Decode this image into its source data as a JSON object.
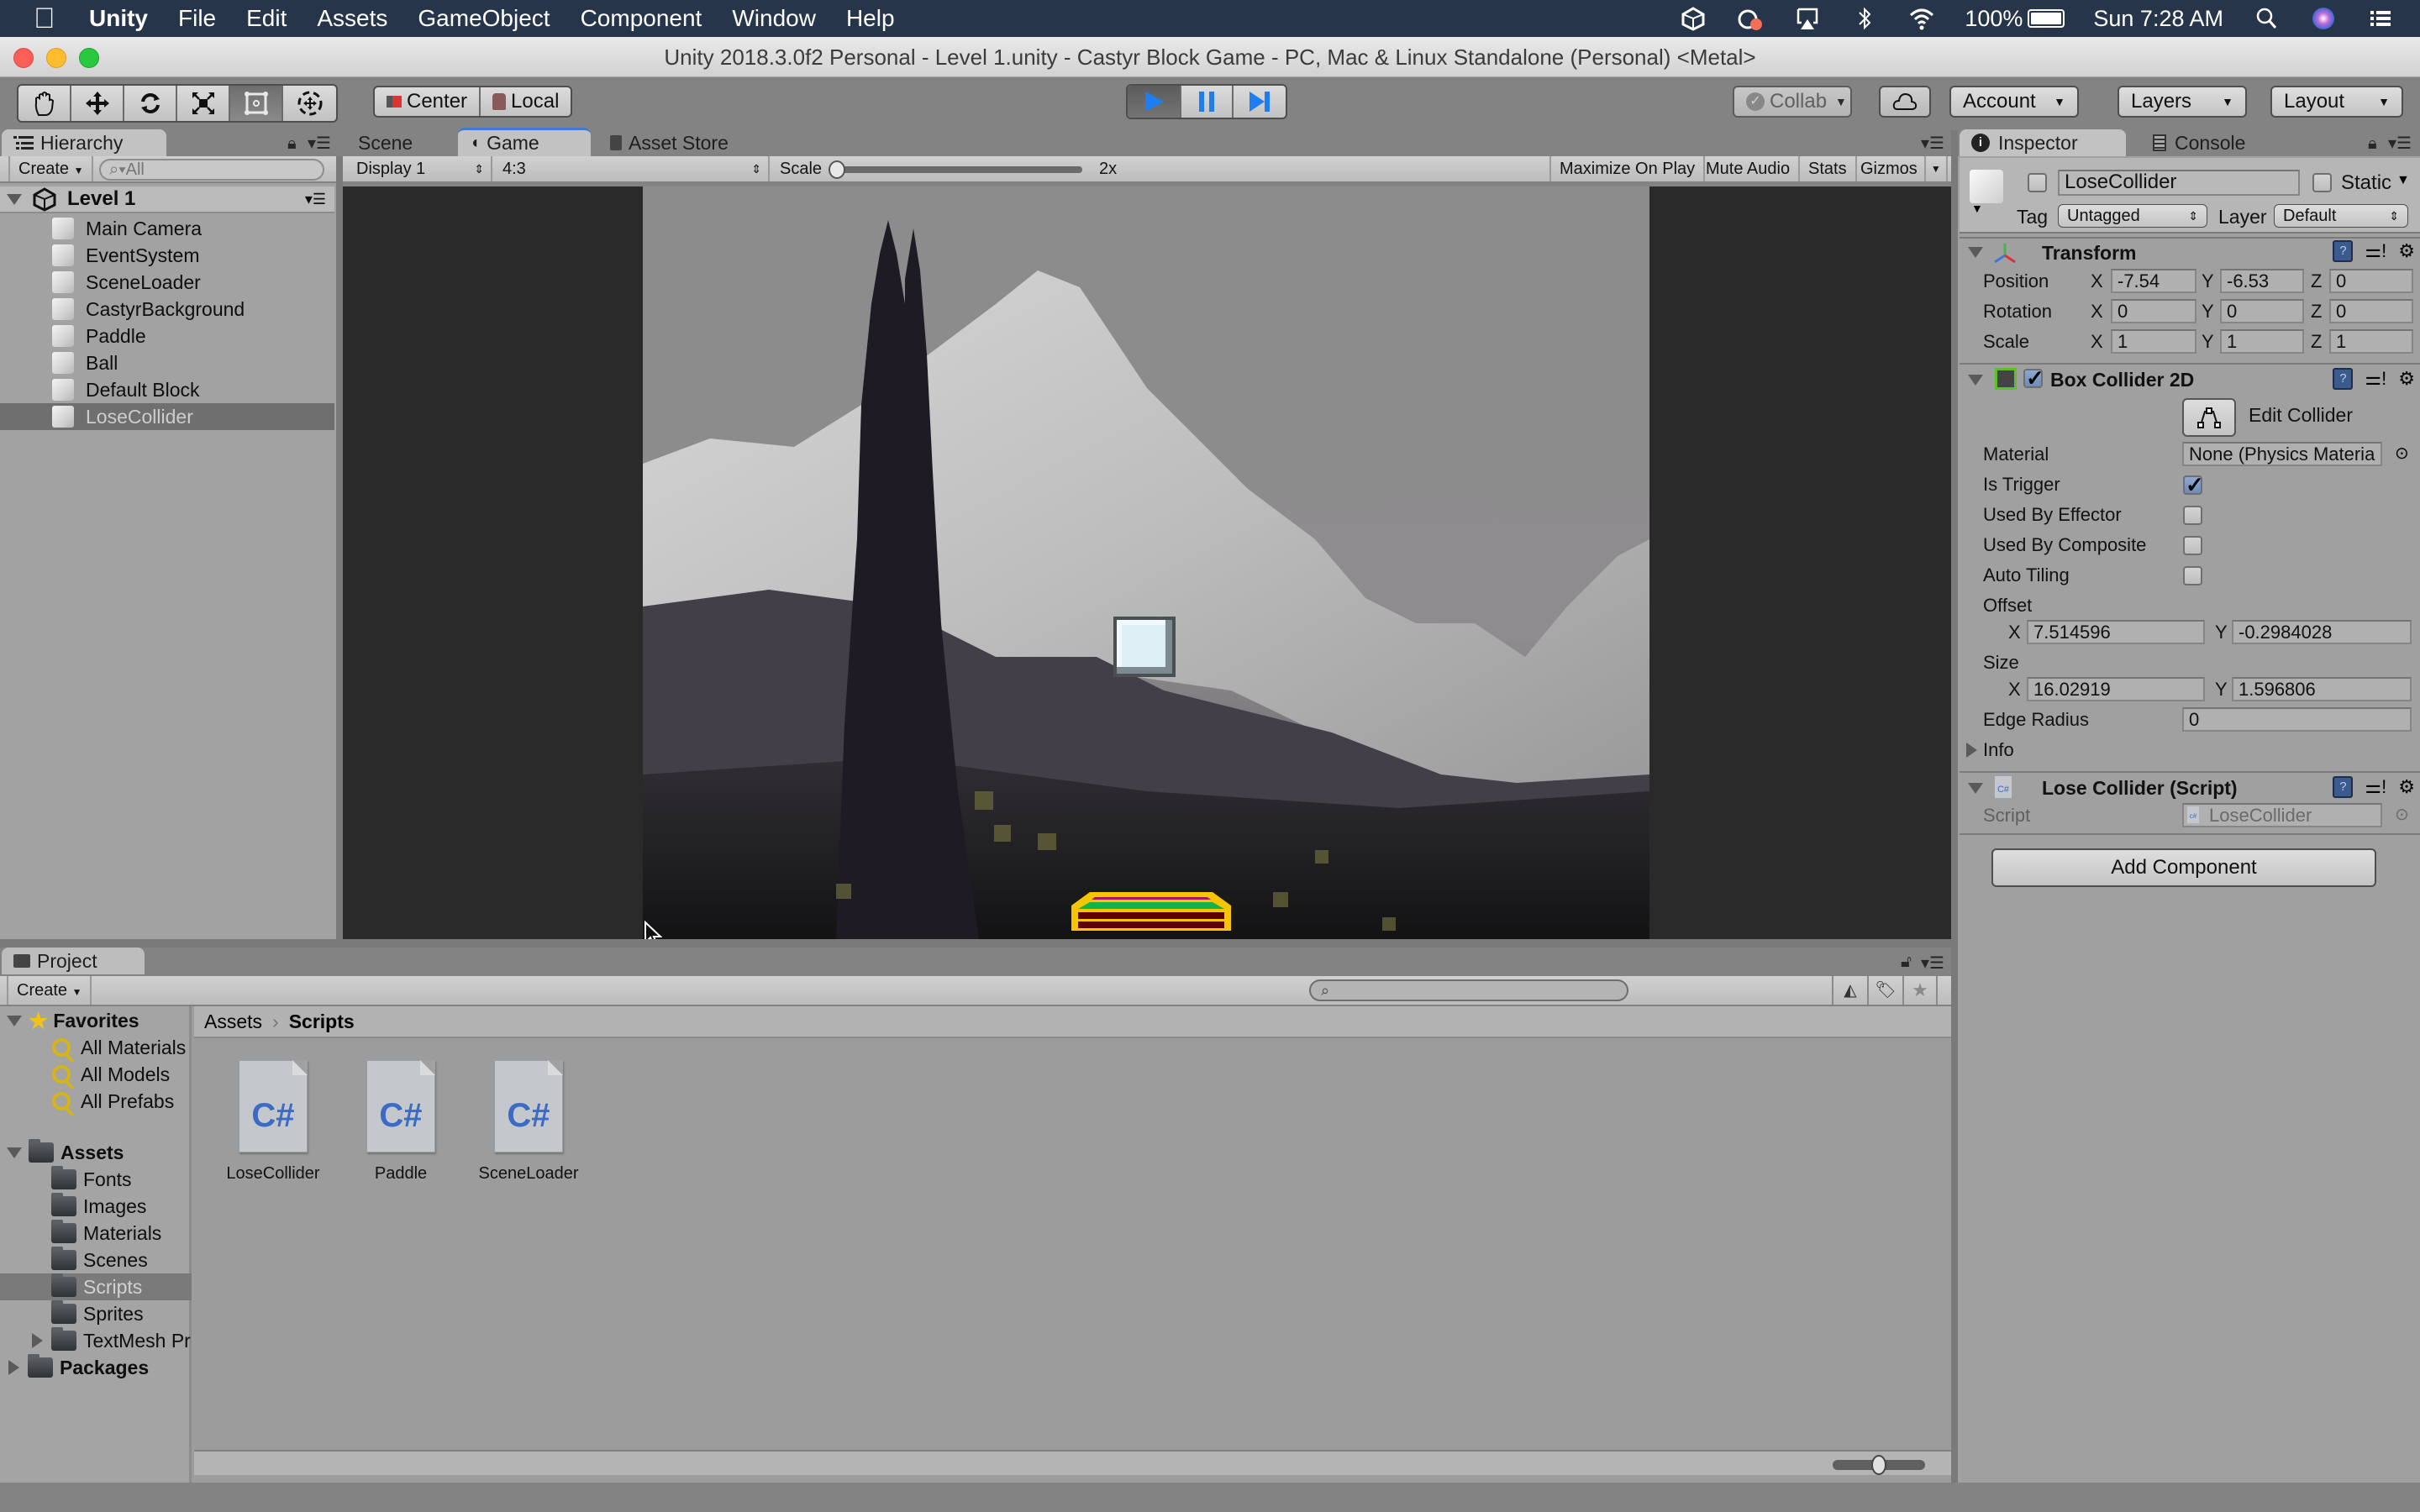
{
  "menubar": {
    "app_name": "Unity",
    "items": [
      "File",
      "Edit",
      "Assets",
      "GameObject",
      "Component",
      "Window",
      "Help"
    ],
    "status": {
      "battery": "100%",
      "clock": "Sun 7:28 AM",
      "icons": [
        "unity-hub-icon",
        "creative-cloud-icon",
        "airplay-icon",
        "bluetooth-icon",
        "wifi-icon",
        "battery-icon",
        "spotlight-icon",
        "siri-icon",
        "notification-center-icon"
      ]
    }
  },
  "window": {
    "title": "Unity 2018.3.0f2 Personal - Level 1.unity - Castyr Block Game - PC, Mac & Linux Standalone (Personal) <Metal>"
  },
  "toolbar": {
    "tools": [
      "hand",
      "move",
      "rotate",
      "scale",
      "rect",
      "transform"
    ],
    "active_tool": "rect",
    "pivot_mode": "Center",
    "pivot_rotation": "Local",
    "play_state": "playing",
    "collab_label": "Collab",
    "account_label": "Account",
    "layers_label": "Layers",
    "layout_label": "Layout"
  },
  "hierarchy": {
    "tab_label": "Hierarchy",
    "create_label": "Create",
    "search_placeholder": "All",
    "scene_name": "Level 1",
    "items": [
      {
        "label": "Main Camera",
        "selected": false
      },
      {
        "label": "EventSystem",
        "selected": false
      },
      {
        "label": "SceneLoader",
        "selected": false
      },
      {
        "label": "CastyrBackground",
        "selected": false
      },
      {
        "label": "Paddle",
        "selected": false
      },
      {
        "label": "Ball",
        "selected": false
      },
      {
        "label": "Default Block",
        "selected": false
      },
      {
        "label": "LoseCollider",
        "selected": true
      }
    ]
  },
  "center_tabs": {
    "tabs": [
      {
        "label": "Scene",
        "active": false
      },
      {
        "label": "Game",
        "active": true
      },
      {
        "label": "Asset Store",
        "active": false
      }
    ]
  },
  "game_view": {
    "display": "Display 1",
    "aspect": "4:3",
    "scale_label": "Scale",
    "scale_value": "2x",
    "scale_slider_fraction": 0.0,
    "buttons": [
      "Maximize On Play",
      "Mute Audio",
      "Stats",
      "Gizmos"
    ]
  },
  "inspector": {
    "tabs": [
      {
        "label": "Inspector",
        "active": true
      },
      {
        "label": "Console",
        "active": false
      }
    ],
    "object": {
      "active": false,
      "name": "LoseCollider",
      "static_label": "Static",
      "static": false,
      "tag_label": "Tag",
      "tag": "Untagged",
      "layer_label": "Layer",
      "layer": "Default"
    },
    "transform": {
      "title": "Transform",
      "rows": [
        {
          "label": "Position",
          "x": "-7.54",
          "y": "-6.53",
          "z": "0"
        },
        {
          "label": "Rotation",
          "x": "0",
          "y": "0",
          "z": "0"
        },
        {
          "label": "Scale",
          "x": "1",
          "y": "1",
          "z": "1"
        }
      ]
    },
    "box_collider": {
      "title": "Box Collider 2D",
      "enabled": true,
      "edit_collider_label": "Edit Collider",
      "material_label": "Material",
      "material_value": "None (Physics Materia",
      "is_trigger_label": "Is Trigger",
      "is_trigger": true,
      "used_by_effector_label": "Used By Effector",
      "used_by_effector": false,
      "used_by_composite_label": "Used By Composite",
      "used_by_composite": false,
      "auto_tiling_label": "Auto Tiling",
      "auto_tiling": false,
      "offset_label": "Offset",
      "offset_x": "7.514596",
      "offset_y": "-0.2984028",
      "size_label": "Size",
      "size_x": "16.02919",
      "size_y": "1.596806",
      "edge_radius_label": "Edge Radius",
      "edge_radius": "0",
      "info_label": "Info"
    },
    "script_component": {
      "title": "Lose Collider (Script)",
      "script_label": "Script",
      "script_value": "LoseCollider"
    },
    "add_component_label": "Add Component"
  },
  "project": {
    "tab_label": "Project",
    "create_label": "Create",
    "search_placeholder": "",
    "favorites_label": "Favorites",
    "favorites": [
      "All Materials",
      "All Models",
      "All Prefabs"
    ],
    "assets_label": "Assets",
    "asset_folders": [
      {
        "label": "Fonts",
        "selected": false,
        "expandable": false
      },
      {
        "label": "Images",
        "selected": false,
        "expandable": false
      },
      {
        "label": "Materials",
        "selected": false,
        "expandable": false
      },
      {
        "label": "Scenes",
        "selected": false,
        "expandable": false
      },
      {
        "label": "Scripts",
        "selected": true,
        "expandable": false
      },
      {
        "label": "Sprites",
        "selected": false,
        "expandable": false
      },
      {
        "label": "TextMesh Pr",
        "selected": false,
        "expandable": true
      }
    ],
    "packages_label": "Packages",
    "breadcrumb": [
      "Assets",
      "Scripts"
    ],
    "files": [
      {
        "name": "LoseCollider",
        "type": "C#"
      },
      {
        "name": "Paddle",
        "type": "C#"
      },
      {
        "name": "SceneLoader",
        "type": "C#"
      }
    ],
    "icon_size_fraction": 0.5
  },
  "colors": {
    "play_blue": "#1e7ef0",
    "selection_gray": "#6f6f6f",
    "menubar_bg": "#27354a",
    "panel_bg": "#a2a2a2",
    "csharp_blue": "#3c6bc4",
    "paddle_yellow": "#f7c500",
    "paddle_green": "#12b347",
    "paddle_maroon": "#5e0000",
    "block_light_blue": "#deeff5"
  }
}
